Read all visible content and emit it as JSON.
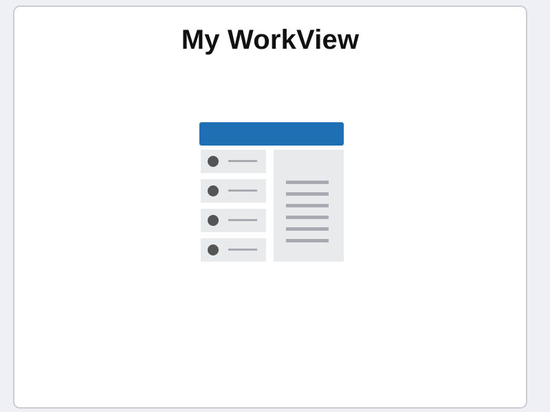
{
  "tile": {
    "title": "My WorkView",
    "icon": "workview-list-detail-icon"
  },
  "colors": {
    "page_background": "#eef0f5",
    "tile_background": "#ffffff",
    "tile_border": "#c9ced6",
    "icon_header": "#1f6fb5",
    "icon_panel": "#e8eaec",
    "icon_dot": "#555555",
    "icon_line": "#a7abb1"
  }
}
